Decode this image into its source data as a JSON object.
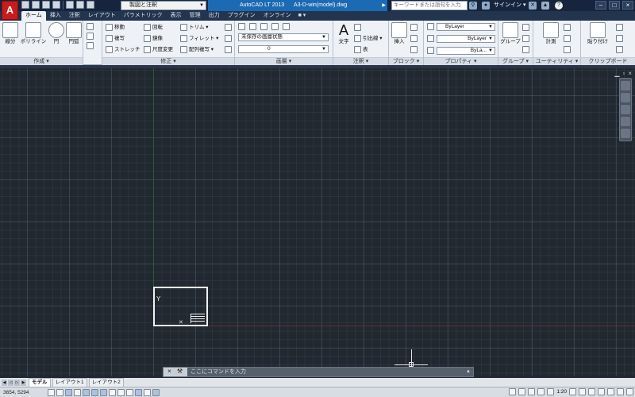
{
  "app_menu": {
    "label": "A"
  },
  "quick_access": {
    "workspace": "製図と注釈",
    "icons": [
      "new-icon",
      "open-icon",
      "save-icon",
      "saveas-icon",
      "plot-icon",
      "undo-icon",
      "redo-icon"
    ]
  },
  "title": {
    "app": "AutoCAD LT 2013",
    "file": "A3-D-win(model).dwg"
  },
  "search": {
    "placeholder": "キーワードまたは語句を入力"
  },
  "signin": {
    "label": "サインイン"
  },
  "window_buttons": {
    "minimize": "–",
    "maximize": "□",
    "close": "×"
  },
  "tabs": [
    "ホーム",
    "挿入",
    "注釈",
    "レイアウト",
    "パラメトリック",
    "表示",
    "管理",
    "出力",
    "プラグイン",
    "オンライン"
  ],
  "ribbon": {
    "draw": {
      "title": "作成 ▾",
      "line": "線分",
      "polyline": "ポリライン",
      "circle": "円",
      "arc": "円弧"
    },
    "modify": {
      "title": "修正 ▾",
      "move": "移動",
      "rotate": "回転",
      "trim": "トリム ▾",
      "copy": "複写",
      "mirror": "鏡像",
      "fillet": "フィレット ▾",
      "stretch": "ストレッチ",
      "scale": "尺度変更",
      "array": "配列複写 ▾"
    },
    "layers": {
      "title": "画層 ▾",
      "layer_state": "未保存の画層状態",
      "current_layer": "0"
    },
    "annotation": {
      "title": "注釈 ▾",
      "text": "文字",
      "leader": "引出線 ▾",
      "table": "表"
    },
    "block": {
      "title": "ブロック ▾",
      "insert": "挿入"
    },
    "properties": {
      "title": "プロパティ ▾",
      "color": "ByLayer",
      "linetype": "ByLayer",
      "lineweight": "ByLa..."
    },
    "groups": {
      "title": "グループ ▾",
      "group": "グループ"
    },
    "utilities": {
      "title": "ユーティリティ ▾",
      "measure": "計測"
    },
    "clipboard": {
      "title": "クリップボード",
      "paste": "貼り付け"
    }
  },
  "viewport_controls": {
    "minimize": "▁",
    "restore": "▫",
    "close": "×"
  },
  "command_line": {
    "placeholder": "ここにコマンドを入力"
  },
  "layout_tabs": {
    "model": "モデル",
    "layout1": "レイアウト1",
    "layout2": "レイアウト2"
  },
  "status": {
    "coordinates": "3654, 5294",
    "annotation_scale": "1:20"
  }
}
